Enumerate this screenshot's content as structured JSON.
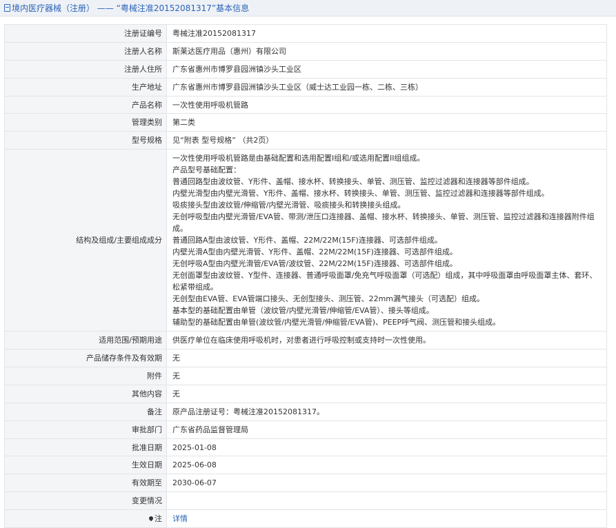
{
  "header": {
    "category": "境内医疗器械（注册）",
    "separator": " —— ",
    "title": "“粤械注准20152081317”基本信息"
  },
  "rows": [
    {
      "label": "注册证编号",
      "value": "粤械注准20152081317"
    },
    {
      "label": "注册人名称",
      "value": "斯莱达医疗用品（惠州）有限公司"
    },
    {
      "label": "注册人住所",
      "value": "广东省惠州市博罗县园洲镇沙头工业区"
    },
    {
      "label": "生产地址",
      "value": "广东省惠州市博罗县园洲镇沙头工业区（威士达工业园一栋、二栋、三栋）"
    },
    {
      "label": "产品名称",
      "value": "一次性使用呼吸机管路"
    },
    {
      "label": "管理类别",
      "value": "第二类"
    },
    {
      "label": "型号规格",
      "value": "见“附表 型号规格” （共2页）"
    }
  ],
  "structure": {
    "label": "结构及组成/主要组成成分",
    "lines": [
      "一次性使用呼吸机管路是由基础配置和选用配置I组和/或选用配置II组组成。",
      "产品型号基础配置：",
      "普通回路型由波纹管、Y形件、盖帽、接水杯、转换接头、单管、测压管、监控过滤器和连接器等部件组成。",
      "内壁光滑型由内壁光滑管、Y形件、盖帽、接水杯、转换接头、单管、测压管、监控过滤器和连接器等部件组成。",
      "吸痰接头型由波纹管/伸缩管/内壁光滑管、吸痰接头和转换接头组成。",
      "无创呼吸型由内壁光滑管/EVA管、带测/泄压口连接器、盖帽、接水杯、转换接头、单管、测压管、监控过滤器和连接器附件组成。",
      "普通回路A型由波纹管、Y形件、盖帽、22M/22M(15F)连接器、可选部件组成。",
      "内壁光滑A型由内壁光滑管、Y形件、盖帽、22M/22M(15F)连接器、可选部件组成。",
      "无创呼吸A型由内壁光滑管/EVA管/波纹管、22M/22M(15F)连接器、可选部件组成。",
      "无创面罩型由波纹管、Y型件、连接器、普通呼吸面罩/免充气呼吸面罩（可选配）组成，其中呼吸面罩由呼吸面罩主体、套环、松紧带组成。",
      "无创型由EVA管、EVA管端口接头、无创型接头、测压管、22mm漏气接头（可选配）组成。",
      "基本型的基础配置由单管（波纹管/内壁光滑管/伸缩管/EVA管）、接头等组成。",
      "辅助型的基础配置由单管(波纹管/内壁光滑管/伸缩管/EVA管)、PEEP呼气阀、测压管和接头组成。"
    ]
  },
  "rows2": [
    {
      "label": "适用范围/预期用途",
      "value": "供医疗单位在临床使用呼吸机时，对患者进行呼吸控制或支持时一次性使用。"
    },
    {
      "label": "产品储存条件及有效期",
      "value": "无"
    },
    {
      "label": "附件",
      "value": "无"
    },
    {
      "label": "其他内容",
      "value": "无"
    },
    {
      "label": "备注",
      "value": "原产品注册证号：粤械注准20152081317。"
    },
    {
      "label": "审批部门",
      "value": "广东省药品监督管理局"
    },
    {
      "label": "批准日期",
      "value": "2025-01-08"
    },
    {
      "label": "生效日期",
      "value": "2025-06-08"
    },
    {
      "label": "有效期至",
      "value": "2030-06-07"
    },
    {
      "label": "变更情况",
      "value": ""
    }
  ],
  "note": {
    "label": "注",
    "link": "详情"
  },
  "icons": {
    "header_icon": "document-icon",
    "note_icon": "location-pin-icon"
  },
  "colors": {
    "link": "#2a64b7",
    "label_bg": "#f4f5f7",
    "border": "#e1e4e8"
  }
}
